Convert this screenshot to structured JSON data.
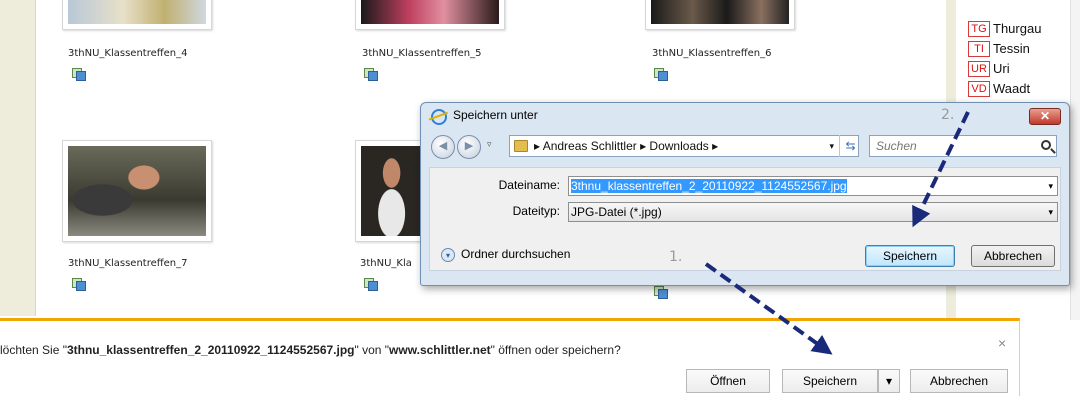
{
  "gallery": {
    "captions": [
      "3thNU_Klassentreffen_4",
      "3thNU_Klassentreffen_5",
      "3thNU_Klassentreffen_6",
      "3thNU_Klassentreffen_7",
      "3thNU_Kla"
    ]
  },
  "cantons": [
    {
      "code": "TG",
      "name": "Thurgau"
    },
    {
      "code": "TI",
      "name": "Tessin"
    },
    {
      "code": "UR",
      "name": "Uri"
    },
    {
      "code": "VD",
      "name": "Waadt"
    }
  ],
  "dialog": {
    "title": "Speichern unter",
    "close": "✕",
    "path": "▸ Andreas Schlittler ▸ Downloads ▸",
    "search_placeholder": "Suchen",
    "filename_label": "Dateiname:",
    "filename_value": "3thnu_klassentreffen_2_20110922_1124552567.jpg",
    "filetype_label": "Dateityp:",
    "filetype_value": "JPG-Datei (*.jpg)",
    "browse_label": "Ordner durchsuchen",
    "save_button": "Speichern",
    "cancel_button": "Abbrechen"
  },
  "annotations": {
    "step1": "1.",
    "step2": "2."
  },
  "notification": {
    "prefix": "löchten Sie \"",
    "filename": "3thnu_klassentreffen_2_20110922_1124552567.jpg",
    "middle": "\" von \"",
    "site": "www.schlittler.net",
    "suffix": "\" öffnen oder speichern?",
    "close": "×",
    "open_button": "Öffnen",
    "save_button": "Speichern",
    "save_dropdown": "▾",
    "cancel_button": "Abbrechen"
  },
  "colors": {
    "notification_accent": "#f0a500",
    "arrow": "#1a2a7a",
    "canton_border": "#d83a3a"
  }
}
